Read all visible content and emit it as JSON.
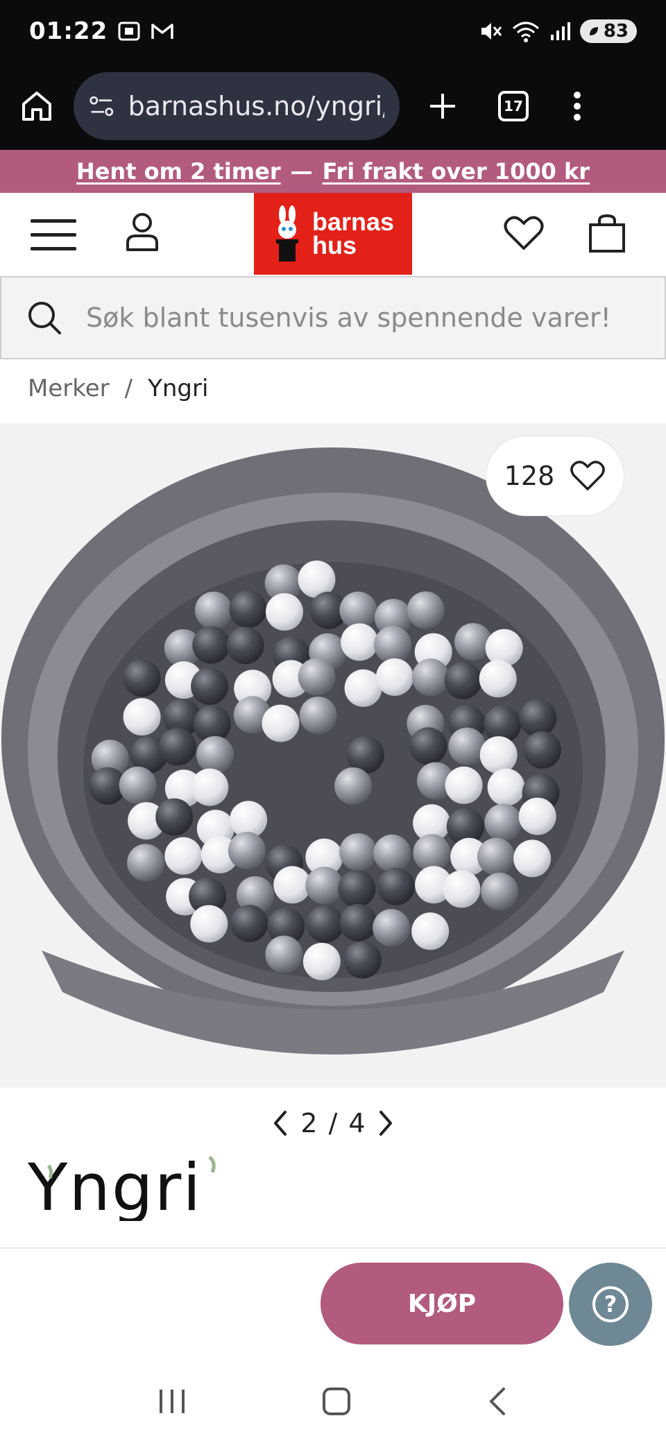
{
  "status": {
    "time": "01:22",
    "battery": "83"
  },
  "browser": {
    "url": "barnashus.no/yngri/b",
    "tab_count": "17"
  },
  "promo": {
    "part1": "Hent om 2 timer",
    "separator": "—",
    "part2": "Fri frakt over 1000 kr"
  },
  "logo": {
    "line1": "barnas",
    "line2": "hus"
  },
  "search": {
    "placeholder": "Søk blant tusenvis av spennende varer!"
  },
  "breadcrumb": {
    "items": [
      "Merker",
      "Yngri"
    ],
    "separator": "/"
  },
  "product": {
    "favorite_count": "128",
    "pager": {
      "current": "2",
      "separator": "/",
      "total": "4"
    },
    "brand": "Yngri"
  },
  "actions": {
    "buy_label": "KJØP",
    "help_label": "?"
  },
  "colors": {
    "brand_pink": "#b35b7f",
    "logo_red": "#e32119",
    "help_blue": "#6f8896"
  }
}
